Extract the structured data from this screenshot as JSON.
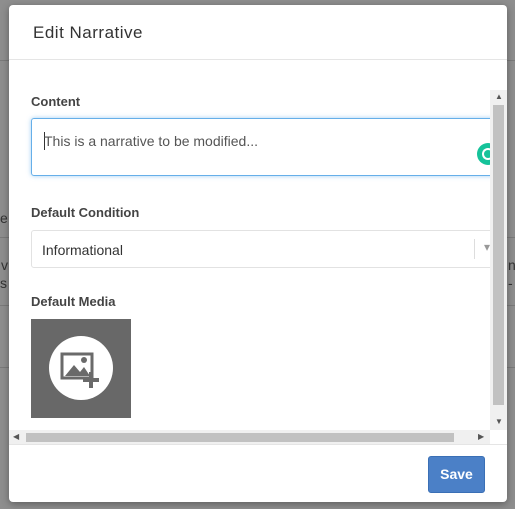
{
  "modal": {
    "title": "Edit Narrative"
  },
  "content": {
    "label": "Content",
    "value": "This is a narrative to be modified..."
  },
  "condition": {
    "label": "Default Condition",
    "value": "Informational"
  },
  "media": {
    "label": "Default Media",
    "icon": "add-image-icon"
  },
  "footer": {
    "save_label": "Save"
  },
  "background": {
    "frag_e": "e",
    "frag_v": "v",
    "frag_s": "s a",
    "frag_n": "n",
    "frag_dash": "-"
  },
  "colors": {
    "accent": "#4b80c7",
    "focus_border": "#66afe9",
    "grammarly": "#15c39a",
    "overlay": "#8e8e8e"
  }
}
